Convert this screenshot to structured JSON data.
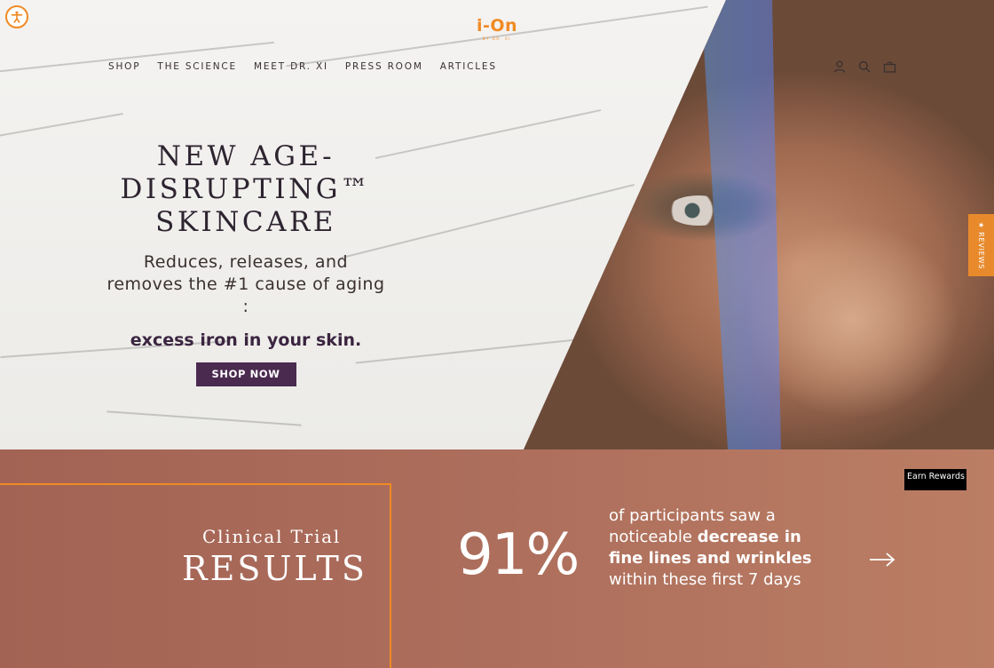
{
  "header": {
    "logo": {
      "text": "i-On",
      "sub": "BY DR. XI"
    },
    "nav": [
      {
        "label": "SHOP"
      },
      {
        "label": "THE SCIENCE"
      },
      {
        "label": "MEET DR. XI"
      },
      {
        "label": "PRESS ROOM"
      },
      {
        "label": "ARTICLES"
      }
    ],
    "icons": [
      "account-icon",
      "search-icon",
      "cart-icon"
    ]
  },
  "hero": {
    "headline": "NEW AGE-DISRUPTING™ SKINCARE",
    "subline": "Reduces, releases, and removes the #1 cause of aging :",
    "emphasis": "excess iron in your skin.",
    "cta": "SHOP NOW"
  },
  "reviews_tab": {
    "label": "★ REVIEWS"
  },
  "results": {
    "small_title": "Clinical Trial",
    "big_title": "RESULTS",
    "stat": "91%",
    "desc_1": "of participants saw a noticeable ",
    "desc_bold": "decrease in fine lines and wrinkles",
    "desc_2": " within these first 7 days",
    "earn_rewards": "Earn Rewards"
  },
  "colors": {
    "accent_orange": "#f08a24",
    "brand_purple": "#4b2a50",
    "band_start": "#a36354",
    "band_end": "#bb7e64"
  }
}
